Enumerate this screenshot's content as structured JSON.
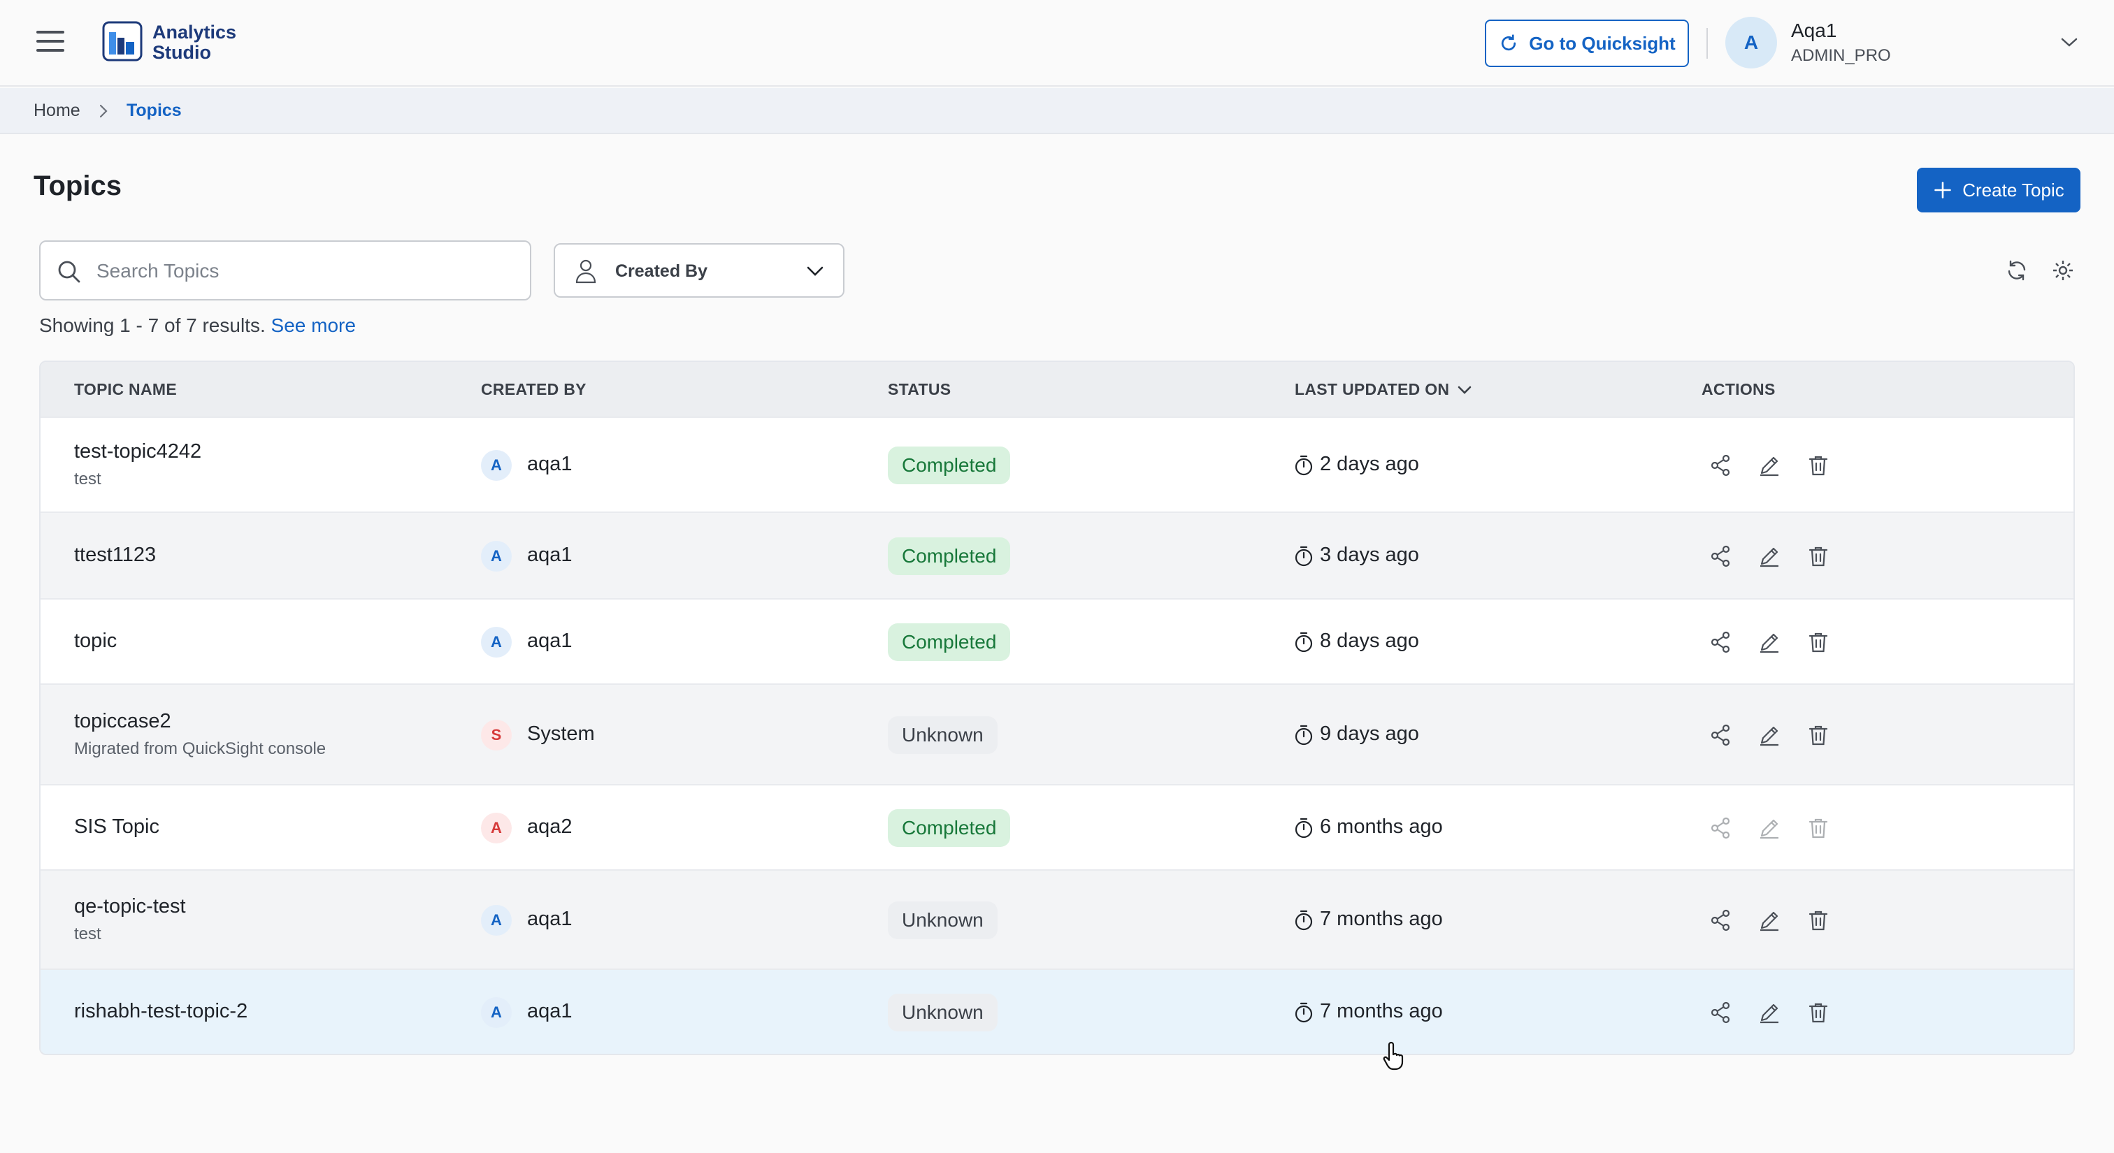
{
  "header": {
    "brand_line1": "Analytics",
    "brand_line2": "Studio",
    "quicksight_label": "Go to Quicksight",
    "user_initial": "A",
    "user_name": "Aqa1",
    "user_role": "ADMIN_PRO"
  },
  "breadcrumb": {
    "home": "Home",
    "current": "Topics"
  },
  "page": {
    "title": "Topics",
    "create_label": "Create Topic",
    "search_placeholder": "Search Topics",
    "search_value": "",
    "created_by_label": "Created By",
    "results_text": "Showing 1 - 7 of 7 results.",
    "see_more": "See more"
  },
  "table": {
    "columns": [
      "TOPIC NAME",
      "CREATED BY",
      "STATUS",
      "LAST UPDATED ON",
      "ACTIONS"
    ],
    "rows": [
      {
        "name": "test-topic4242",
        "desc": "test",
        "initial": "A",
        "creator": "aqa1",
        "status": "Completed",
        "updated": "2 days ago"
      },
      {
        "name": "ttest1123",
        "desc": "",
        "initial": "A",
        "creator": "aqa1",
        "status": "Completed",
        "updated": "3 days ago"
      },
      {
        "name": "topic",
        "desc": "",
        "initial": "A",
        "creator": "aqa1",
        "status": "Completed",
        "updated": "8 days ago"
      },
      {
        "name": "topiccase2",
        "desc": "Migrated from QuickSight console",
        "initial": "S",
        "creator": "System",
        "status": "Unknown",
        "updated": "9 days ago"
      },
      {
        "name": "SIS Topic",
        "desc": "",
        "initial": "A",
        "creator": "aqa2",
        "status": "Completed",
        "updated": "6 months ago"
      },
      {
        "name": "qe-topic-test",
        "desc": "test",
        "initial": "A",
        "creator": "aqa1",
        "status": "Unknown",
        "updated": "7 months ago"
      },
      {
        "name": "rishabh-test-topic-2",
        "desc": "",
        "initial": "A",
        "creator": "aqa1",
        "status": "Unknown",
        "updated": "7 months ago"
      }
    ]
  },
  "icons": {
    "menu": "hamburger-menu-icon",
    "logo": "analytics-studio-logo-icon",
    "quicksight": "external-refresh-icon",
    "search": "search-icon",
    "person": "person-icon",
    "refresh": "refresh-icon",
    "settings": "gear-icon",
    "clock": "timer-icon",
    "share": "share-icon",
    "edit": "pencil-icon",
    "delete": "trash-icon"
  },
  "colors": {
    "primary": "#1463c4",
    "completed_bg": "#d9f2df",
    "completed_text": "#18783a",
    "unknown_bg": "#eceef1",
    "hover_row": "#e8f3fb"
  }
}
